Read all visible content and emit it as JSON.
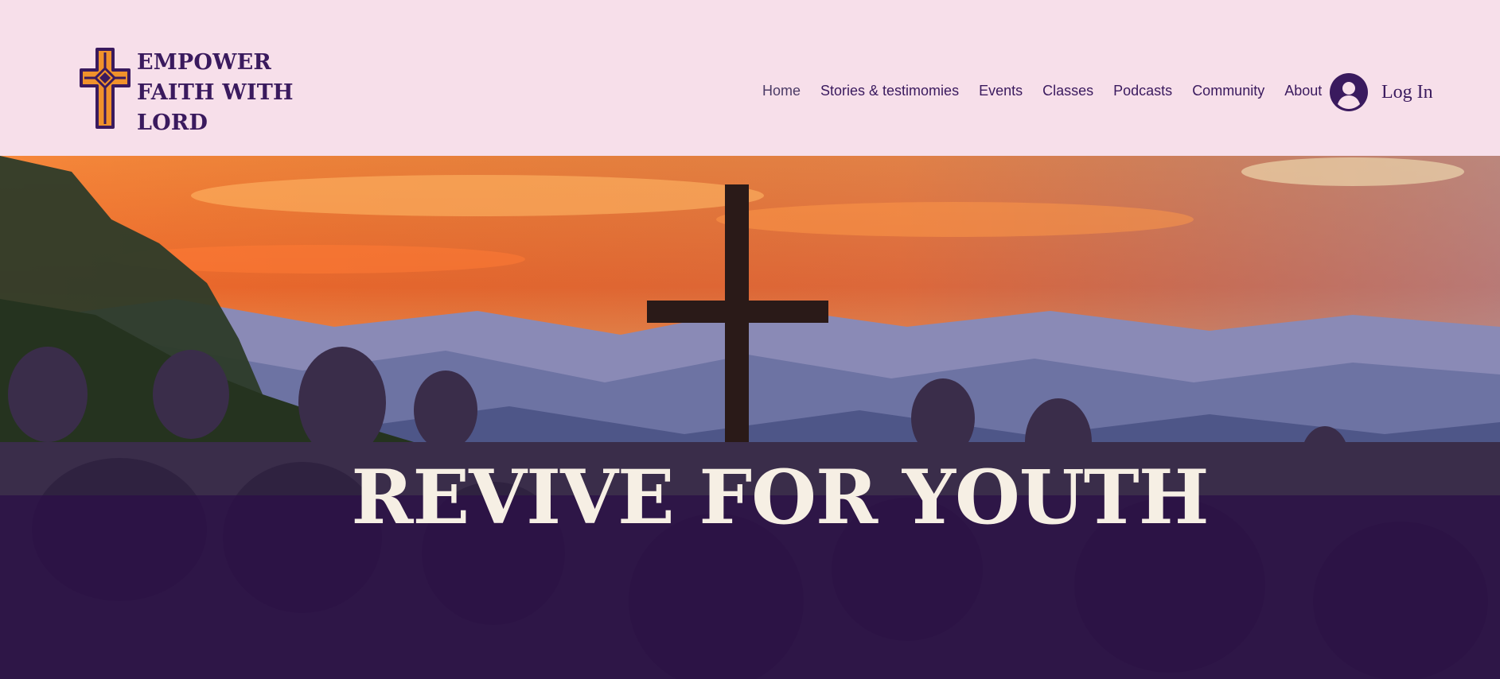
{
  "header": {
    "logo": {
      "icon": "cross-icon",
      "lines": [
        "EMPOWER",
        "FAITH WITH",
        "LORD"
      ]
    },
    "nav": [
      {
        "label": "Home"
      },
      {
        "label": "Stories & testimomies"
      },
      {
        "label": "Events"
      },
      {
        "label": "Classes"
      },
      {
        "label": "Podcasts"
      },
      {
        "label": "Community"
      },
      {
        "label": "About"
      }
    ],
    "login": {
      "icon": "user-avatar-icon",
      "label": "Log In"
    }
  },
  "hero": {
    "title": "REVIVE FOR YOUTH",
    "image": "sunset-mountain-cross-crowd"
  },
  "colors": {
    "header_bg": "#f7dfea",
    "brand_purple": "#3a1a5e",
    "logo_orange": "#f0922b",
    "hero_text": "#f6efe4",
    "hero_band": "#2b0f46"
  }
}
